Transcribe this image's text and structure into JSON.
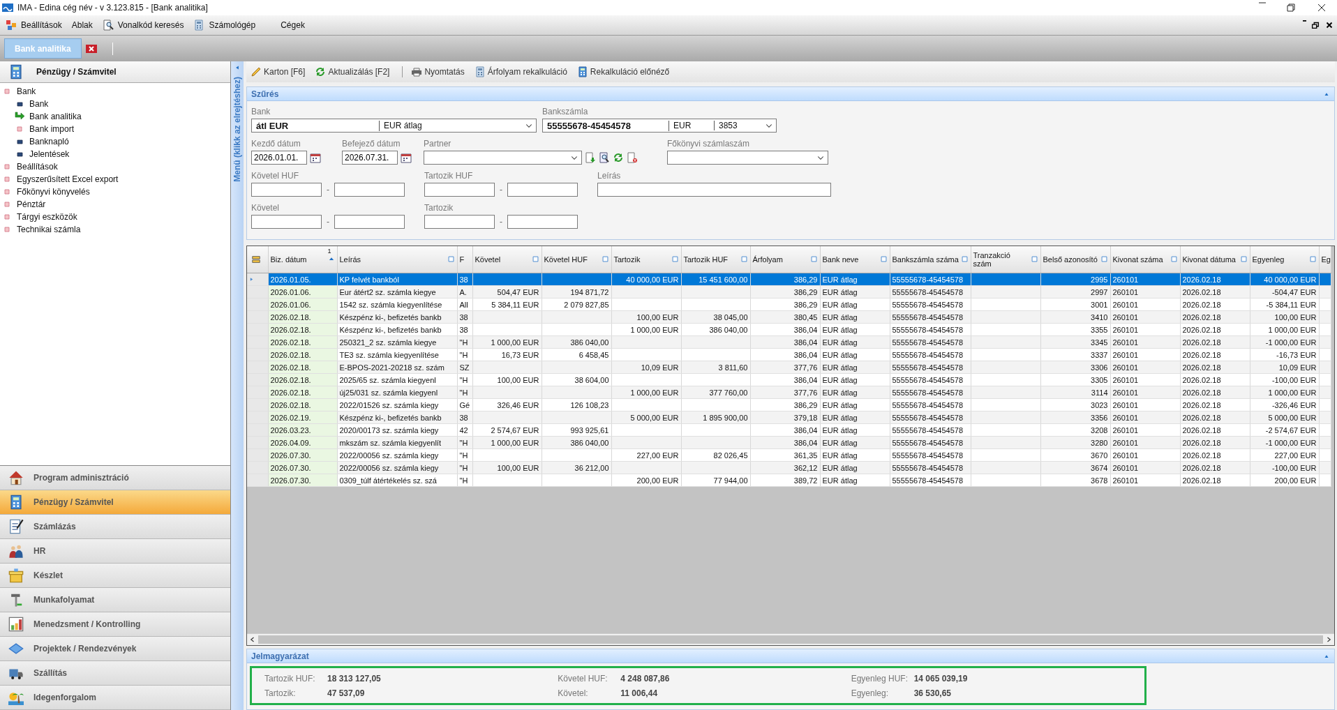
{
  "window": {
    "title": "IMA - Edina cég név - v 3.123.815 - [Bank analitika]"
  },
  "menu": [
    {
      "label": "Beállítások",
      "kind": "app"
    },
    {
      "label": "Ablak",
      "kind": "plain"
    },
    {
      "label": "Vonalkód keresés",
      "kind": "search"
    },
    {
      "label": "Számológép",
      "kind": "sheet"
    },
    {
      "label": "Cégek",
      "kind": "plain"
    }
  ],
  "tabs": [
    {
      "label": "Bank analitika",
      "selected": true
    }
  ],
  "sidebar": {
    "title": "Pénzügy / Számvitel",
    "collapse_label": "Menü (klikk az elrejtéshez)",
    "tree": [
      {
        "label": "Bank",
        "kind": "group",
        "selected": false,
        "children": [
          {
            "label": "Bank",
            "kind": "item",
            "selected": false
          },
          {
            "label": "Bank analitika",
            "kind": "item",
            "selected": true
          },
          {
            "label": "Bank import",
            "kind": "group",
            "selected": false
          },
          {
            "label": "Banknapló",
            "kind": "item",
            "selected": false
          },
          {
            "label": "Jelentések",
            "kind": "item",
            "selected": false
          }
        ]
      },
      {
        "label": "Beállítások",
        "kind": "group",
        "selected": false
      },
      {
        "label": "Egyszerűsített Excel export",
        "kind": "group",
        "selected": false
      },
      {
        "label": "Főkönyvi könyvelés",
        "kind": "group",
        "selected": false
      },
      {
        "label": "Pénztár",
        "kind": "group",
        "selected": false
      },
      {
        "label": "Tárgyi eszközök",
        "kind": "group",
        "selected": false
      },
      {
        "label": "Technikai számla",
        "kind": "group",
        "selected": false
      }
    ],
    "modules": [
      {
        "label": "Program adminisztráció",
        "kind": "house",
        "selected": false
      },
      {
        "label": "Pénzügy / Számvitel",
        "kind": "calc",
        "selected": true
      },
      {
        "label": "Számlázás",
        "kind": "doc",
        "selected": false
      },
      {
        "label": "HR",
        "kind": "people",
        "selected": false
      },
      {
        "label": "Készlet",
        "kind": "box",
        "selected": false
      },
      {
        "label": "Munkafolyamat",
        "kind": "tools",
        "selected": false
      },
      {
        "label": "Menedzsment / Kontrolling",
        "kind": "bars",
        "selected": false
      },
      {
        "label": "Projektek / Rendezvények",
        "kind": "card",
        "selected": false
      },
      {
        "label": "Szállítás",
        "kind": "truck",
        "selected": false
      },
      {
        "label": "Idegenforgalom",
        "kind": "palm",
        "selected": false
      }
    ]
  },
  "toolbar": [
    {
      "label": "Karton [F6]",
      "kind": "pencil",
      "separator_before": false
    },
    {
      "label": "Aktualizálás [F2]",
      "kind": "refresh",
      "separator_before": false
    },
    {
      "label": "Nyomtatás",
      "kind": "printer",
      "separator_before": true
    },
    {
      "label": "Árfolyam rekalkuláció",
      "kind": "sheet",
      "separator_before": false
    },
    {
      "label": "Rekalkuláció előnéző",
      "kind": "calc",
      "separator_before": false
    }
  ],
  "filter": {
    "title": "Szűrés",
    "bank": {
      "label": "Bank",
      "code": "átl EUR",
      "name": "EUR átlag"
    },
    "account": {
      "label": "Bankszámla",
      "number": "55555678-45454578",
      "currency": "EUR",
      "code": "3853"
    },
    "start_date": {
      "label": "Kezdő dátum",
      "value": "2026.01.01."
    },
    "end_date": {
      "label": "Befejező dátum",
      "value": "2026.07.31."
    },
    "partner": {
      "label": "Partner"
    },
    "ledger_account": {
      "label": "Főkönyvi számlaszám"
    },
    "credit_huf": {
      "label": "Követel HUF",
      "separator": "-"
    },
    "debit_huf": {
      "label": "Tartozik HUF",
      "separator": "-"
    },
    "description": {
      "label": "Leírás"
    },
    "credit": {
      "label": "Követel",
      "separator": "-"
    },
    "debit": {
      "label": "Tartozik",
      "separator": "-"
    }
  },
  "table": {
    "sort_index": "1",
    "columns": [
      {
        "label": "Biz. dátum",
        "kind": "text",
        "sorted": true,
        "filter": false
      },
      {
        "label": "Leírás",
        "kind": "text",
        "sorted": false,
        "filter": true
      },
      {
        "label": "F",
        "kind": "text",
        "sorted": false,
        "filter": false
      },
      {
        "label": "Követel",
        "kind": "number",
        "sorted": false,
        "filter": true
      },
      {
        "label": "Követel HUF",
        "kind": "number",
        "sorted": false,
        "filter": true
      },
      {
        "label": "Tartozik",
        "kind": "number",
        "sorted": false,
        "filter": true
      },
      {
        "label": "Tartozik HUF",
        "kind": "number",
        "sorted": false,
        "filter": true
      },
      {
        "label": "Árfolyam",
        "kind": "number",
        "sorted": false,
        "filter": true
      },
      {
        "label": "Bank neve",
        "kind": "text",
        "sorted": false,
        "filter": true
      },
      {
        "label": "Bankszámla száma",
        "kind": "text",
        "sorted": false,
        "filter": true
      },
      {
        "label": "Tranzakció szám",
        "kind": "text",
        "sorted": false,
        "filter": true
      },
      {
        "label": "Belső azonosító",
        "kind": "number",
        "sorted": false,
        "filter": true
      },
      {
        "label": "Kivonat száma",
        "kind": "text",
        "sorted": false,
        "filter": true
      },
      {
        "label": "Kivonat dátuma",
        "kind": "text",
        "sorted": false,
        "filter": true
      },
      {
        "label": "Egyenleg",
        "kind": "number",
        "sorted": false,
        "filter": true
      },
      {
        "label": "Eg",
        "kind": "text",
        "sorted": false,
        "filter": false
      }
    ],
    "rows": [
      {
        "selected": true,
        "cells": [
          "2026.01.05.",
          "KP felvét bankból",
          "38",
          null,
          null,
          "40 000,00 EUR",
          "15 451 600,00",
          "386,29",
          "EUR átlag",
          "55555678-45454578",
          null,
          "2995",
          "260101",
          "2026.02.18",
          "40 000,00 EUR",
          null
        ]
      },
      {
        "selected": false,
        "cells": [
          "2026.01.06.",
          "Eur átért2 sz. számla kiegye",
          "A.",
          "504,47 EUR",
          "194 871,72",
          null,
          null,
          "386,29",
          "EUR átlag",
          "55555678-45454578",
          null,
          "2997",
          "260101",
          "2026.02.18",
          "-504,47 EUR",
          null
        ]
      },
      {
        "selected": false,
        "cells": [
          "2026.01.06.",
          "1542 sz. számla kiegyenlítése",
          "All",
          "5 384,11 EUR",
          "2 079 827,85",
          null,
          null,
          "386,29",
          "EUR átlag",
          "55555678-45454578",
          null,
          "3001",
          "260101",
          "2026.02.18",
          "-5 384,11 EUR",
          null
        ]
      },
      {
        "selected": false,
        "cells": [
          "2026.02.18.",
          "Készpénz ki-, befizetés bankb",
          "38",
          null,
          null,
          "100,00 EUR",
          "38 045,00",
          "380,45",
          "EUR átlag",
          "55555678-45454578",
          null,
          "3410",
          "260101",
          "2026.02.18",
          "100,00 EUR",
          null
        ]
      },
      {
        "selected": false,
        "cells": [
          "2026.02.18.",
          "Készpénz ki-, befizetés bankb",
          "38",
          null,
          null,
          "1 000,00 EUR",
          "386 040,00",
          "386,04",
          "EUR átlag",
          "55555678-45454578",
          null,
          "3355",
          "260101",
          "2026.02.18",
          "1 000,00 EUR",
          null
        ]
      },
      {
        "selected": false,
        "cells": [
          "2026.02.18.",
          "250321_2 sz. számla kiegye",
          "\"H",
          "1 000,00 EUR",
          "386 040,00",
          null,
          null,
          "386,04",
          "EUR átlag",
          "55555678-45454578",
          null,
          "3345",
          "260101",
          "2026.02.18",
          "-1 000,00 EUR",
          null
        ]
      },
      {
        "selected": false,
        "cells": [
          "2026.02.18.",
          "TE3 sz. számla kiegyenlítése",
          "\"H",
          "16,73 EUR",
          "6 458,45",
          null,
          null,
          "386,04",
          "EUR átlag",
          "55555678-45454578",
          null,
          "3337",
          "260101",
          "2026.02.18",
          "-16,73 EUR",
          null
        ]
      },
      {
        "selected": false,
        "cells": [
          "2026.02.18.",
          "E-BPOS-2021-20218 sz. szám",
          "SZ",
          null,
          null,
          "10,09 EUR",
          "3 811,60",
          "377,76",
          "EUR átlag",
          "55555678-45454578",
          null,
          "3306",
          "260101",
          "2026.02.18",
          "10,09 EUR",
          null
        ]
      },
      {
        "selected": false,
        "cells": [
          "2026.02.18.",
          "2025/65 sz. számla kiegyenl",
          "\"H",
          "100,00 EUR",
          "38 604,00",
          null,
          null,
          "386,04",
          "EUR átlag",
          "55555678-45454578",
          null,
          "3305",
          "260101",
          "2026.02.18",
          "-100,00 EUR",
          null
        ]
      },
      {
        "selected": false,
        "cells": [
          "2026.02.18.",
          "új25/031 sz. számla kiegyenl",
          "\"H",
          null,
          null,
          "1 000,00 EUR",
          "377 760,00",
          "377,76",
          "EUR átlag",
          "55555678-45454578",
          null,
          "3114",
          "260101",
          "2026.02.18",
          "1 000,00 EUR",
          null
        ]
      },
      {
        "selected": false,
        "cells": [
          "2026.02.18.",
          "2022/01526 sz. számla kiegy",
          "Gé",
          "326,46 EUR",
          "126 108,23",
          null,
          null,
          "386,29",
          "EUR átlag",
          "55555678-45454578",
          null,
          "3023",
          "260101",
          "2026.02.18",
          "-326,46 EUR",
          null
        ]
      },
      {
        "selected": false,
        "cells": [
          "2026.02.19.",
          "Készpénz ki-, befizetés bankb",
          "38",
          null,
          null,
          "5 000,00 EUR",
          "1 895 900,00",
          "379,18",
          "EUR átlag",
          "55555678-45454578",
          null,
          "3356",
          "260101",
          "2026.02.18",
          "5 000,00 EUR",
          null
        ]
      },
      {
        "selected": false,
        "cells": [
          "2026.03.23.",
          "2020/00173 sz. számla kiegy",
          "42",
          "2 574,67 EUR",
          "993 925,61",
          null,
          null,
          "386,04",
          "EUR átlag",
          "55555678-45454578",
          null,
          "3208",
          "260101",
          "2026.02.18",
          "-2 574,67 EUR",
          null
        ]
      },
      {
        "selected": false,
        "cells": [
          "2026.04.09.",
          "mkszám sz. számla kiegyenlít",
          "\"H",
          "1 000,00 EUR",
          "386 040,00",
          null,
          null,
          "386,04",
          "EUR átlag",
          "55555678-45454578",
          null,
          "3280",
          "260101",
          "2026.02.18",
          "-1 000,00 EUR",
          null
        ]
      },
      {
        "selected": false,
        "cells": [
          "2026.07.30.",
          "2022/00056 sz. számla kiegy",
          "\"H",
          null,
          null,
          "227,00 EUR",
          "82 026,45",
          "361,35",
          "EUR átlag",
          "55555678-45454578",
          null,
          "3670",
          "260101",
          "2026.02.18",
          "227,00 EUR",
          null
        ]
      },
      {
        "selected": false,
        "cells": [
          "2026.07.30.",
          "2022/00056 sz. számla kiegy",
          "\"H",
          "100,00 EUR",
          "36 212,00",
          null,
          null,
          "362,12",
          "EUR átlag",
          "55555678-45454578",
          null,
          "3674",
          "260101",
          "2026.02.18",
          "-100,00 EUR",
          null
        ]
      },
      {
        "selected": false,
        "cells": [
          "2026.07.30.",
          "0309_túlf átértékelés sz. szá",
          "\"H",
          null,
          null,
          "200,00 EUR",
          "77 944,00",
          "389,72",
          "EUR átlag",
          "55555678-45454578",
          null,
          "3678",
          "260101",
          "2026.02.18",
          "200,00 EUR",
          null
        ]
      }
    ]
  },
  "legend": {
    "title": "Jelmagyarázat",
    "items": [
      {
        "label": "Tartozik HUF:",
        "value": "18 313 127,05"
      },
      {
        "label": "Tartozik:",
        "value": "47 537,09"
      },
      {
        "label": "Követel HUF:",
        "value": "4 248 087,86"
      },
      {
        "label": "Követel:",
        "value": "11 006,44"
      },
      {
        "label": "Egyenleg HUF:",
        "value": "14 065 039,19"
      },
      {
        "label": "Egyenleg:",
        "value": "36 530,65"
      }
    ]
  }
}
